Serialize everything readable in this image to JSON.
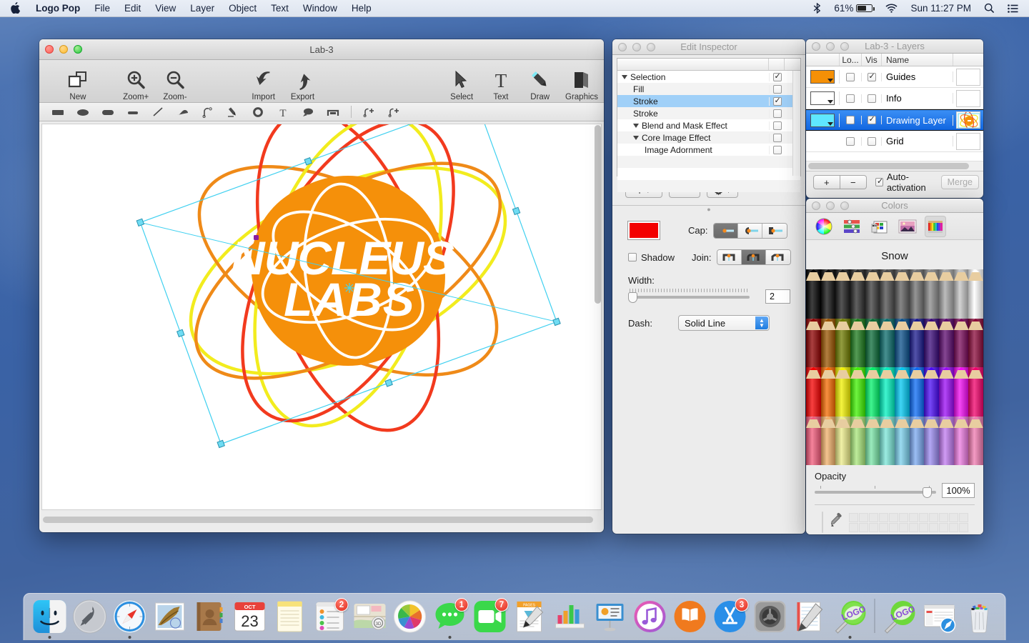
{
  "menubar": {
    "apple_icon": "apple-logo-icon",
    "app_name": "Logo Pop",
    "items": [
      "File",
      "Edit",
      "View",
      "Layer",
      "Object",
      "Text",
      "Window",
      "Help"
    ],
    "status": {
      "bluetooth_icon": "bluetooth-icon",
      "battery_percent": "61%",
      "wifi_icon": "wifi-icon",
      "clock": "Sun 11:27 PM",
      "search_icon": "spotlight-search-icon",
      "notification_icon": "notification-center-icon"
    }
  },
  "document_window": {
    "title": "Lab-3",
    "toolbar": [
      {
        "label": "New",
        "icon": "new-document-icon"
      },
      {
        "label": "Zoom+",
        "icon": "zoom-in-icon"
      },
      {
        "label": "Zoom-",
        "icon": "zoom-out-icon"
      },
      {
        "label": "Import",
        "icon": "import-arrow-icon"
      },
      {
        "label": "Export",
        "icon": "export-arrow-icon"
      },
      {
        "label": "Select",
        "icon": "cursor-arrow-icon"
      },
      {
        "label": "Text",
        "icon": "text-t-icon"
      },
      {
        "label": "Draw",
        "icon": "pencil-draw-icon"
      },
      {
        "label": "Graphics",
        "icon": "graphics-book-icon"
      }
    ],
    "tools": [
      "rectangle-tool-icon",
      "ellipse-tool-icon",
      "rounded-rect-tool-icon",
      "line-thick-tool-icon",
      "line-tool-icon",
      "curve-tool-icon",
      "bezier-tool-icon",
      "pen-tool-icon",
      "circle-outline-tool-icon",
      "text-tool-icon",
      "callout-tool-icon",
      "bracket-tool-icon",
      "add-shape-tool-icon",
      "add-curve-tool-icon"
    ],
    "artwork": {
      "title_line1": "NUCLEUS",
      "title_line2": "LABS",
      "nucleus_color": "#f5900a",
      "orbit_colors": [
        "#f23a1e",
        "#f2ec1e",
        "#ef8a18"
      ]
    }
  },
  "inspector": {
    "title": "Edit Inspector",
    "tree": [
      {
        "label": "Selection",
        "indent": 0,
        "disclosure": true,
        "checked": true,
        "selected": false
      },
      {
        "label": "Fill",
        "indent": 1,
        "disclosure": false,
        "checked": false,
        "selected": false
      },
      {
        "label": "Stroke",
        "indent": 1,
        "disclosure": false,
        "checked": true,
        "selected": true
      },
      {
        "label": "Stroke",
        "indent": 1,
        "disclosure": false,
        "checked": false,
        "selected": false
      },
      {
        "label": "Blend and Mask Effect",
        "indent": 1,
        "disclosure": true,
        "checked": false,
        "selected": false
      },
      {
        "label": "Core Image Effect",
        "indent": 1,
        "disclosure": true,
        "checked": false,
        "selected": false
      },
      {
        "label": "Image Adornment",
        "indent": 2,
        "disclosure": false,
        "checked": false,
        "selected": false
      }
    ],
    "buttons": {
      "add": "+",
      "remove": "−",
      "gear": "gear-icon"
    },
    "stroke": {
      "color": "#f30000",
      "shadow_label": "Shadow",
      "shadow_checked": false,
      "cap_label": "Cap:",
      "cap_selected": 0,
      "join_label": "Join:",
      "join_selected": 1,
      "width_label": "Width:",
      "width_value": "2",
      "dash_label": "Dash:",
      "dash_value": "Solid Line"
    }
  },
  "layers_window": {
    "title": "Lab-3 - Layers",
    "columns": [
      "Lo...",
      "Vis",
      "Name"
    ],
    "rows": [
      {
        "name": "Guides",
        "lock": false,
        "vis": true,
        "selected": false,
        "swatch": "#f59006",
        "has_preview": false
      },
      {
        "name": "Info",
        "lock": false,
        "vis": false,
        "selected": false,
        "swatch": "#ffffff",
        "has_preview": false
      },
      {
        "name": "Drawing Layer",
        "lock": false,
        "vis": true,
        "selected": true,
        "swatch": "#5fe7ff",
        "has_preview": true
      },
      {
        "name": "Grid",
        "lock": false,
        "vis": false,
        "selected": false,
        "swatch": null,
        "has_preview": false
      }
    ],
    "footer": {
      "add": "+",
      "remove": "−",
      "auto_activation_label": "Auto-activation",
      "auto_activation_checked": true,
      "merge_label": "Merge"
    }
  },
  "colors_window": {
    "title": "Colors",
    "tabs": [
      "color-wheel-icon",
      "color-sliders-icon",
      "color-palettes-icon",
      "image-palette-icon",
      "crayons-icon"
    ],
    "active_tab": 4,
    "crayon_name": "Snow",
    "opacity_label": "Opacity",
    "opacity_value": "100%",
    "current_color": "#ffffff",
    "eyedropper_icon": "eyedropper-icon"
  },
  "dock": {
    "items": [
      {
        "name": "Finder",
        "icon": "finder-icon",
        "running": true,
        "badge": null
      },
      {
        "name": "Launchpad",
        "icon": "launchpad-icon",
        "running": false,
        "badge": null
      },
      {
        "name": "Safari",
        "icon": "safari-icon",
        "running": true,
        "badge": null
      },
      {
        "name": "Mail",
        "icon": "mail-icon",
        "running": false,
        "badge": null
      },
      {
        "name": "Contacts",
        "icon": "contacts-icon",
        "running": false,
        "badge": null
      },
      {
        "name": "Calendar",
        "icon": "calendar-icon",
        "running": false,
        "badge": null,
        "month": "OCT",
        "day": "23"
      },
      {
        "name": "Notes",
        "icon": "notes-icon",
        "running": false,
        "badge": null
      },
      {
        "name": "Reminders",
        "icon": "reminders-icon",
        "running": false,
        "badge": "2"
      },
      {
        "name": "Maps",
        "icon": "maps-icon",
        "running": false,
        "badge": null
      },
      {
        "name": "Photos",
        "icon": "photos-icon",
        "running": false,
        "badge": null
      },
      {
        "name": "Messages",
        "icon": "messages-icon",
        "running": true,
        "badge": "1"
      },
      {
        "name": "FaceTime",
        "icon": "facetime-icon",
        "running": false,
        "badge": "7"
      },
      {
        "name": "Pages",
        "icon": "pages-icon",
        "running": false,
        "badge": null
      },
      {
        "name": "Numbers",
        "icon": "numbers-icon",
        "running": false,
        "badge": null
      },
      {
        "name": "Keynote",
        "icon": "keynote-icon",
        "running": false,
        "badge": null
      },
      {
        "name": "iTunes",
        "icon": "itunes-icon",
        "running": false,
        "badge": null
      },
      {
        "name": "iBooks",
        "icon": "ibooks-icon",
        "running": false,
        "badge": null
      },
      {
        "name": "App Store",
        "icon": "app-store-icon",
        "running": false,
        "badge": "3"
      },
      {
        "name": "System Preferences",
        "icon": "system-preferences-icon",
        "running": false,
        "badge": null
      },
      {
        "name": "TextEdit",
        "icon": "textedit-icon",
        "running": false,
        "badge": null
      },
      {
        "name": "Logo Pop",
        "icon": "logo-pop-icon",
        "running": true,
        "badge": null
      }
    ],
    "recent": [
      {
        "name": "Logo Pop Document",
        "icon": "logo-pop-doc-icon"
      },
      {
        "name": "Downloads Stack",
        "icon": "downloads-stack-icon"
      }
    ],
    "trash": {
      "name": "Trash",
      "icon": "trash-full-icon"
    }
  }
}
